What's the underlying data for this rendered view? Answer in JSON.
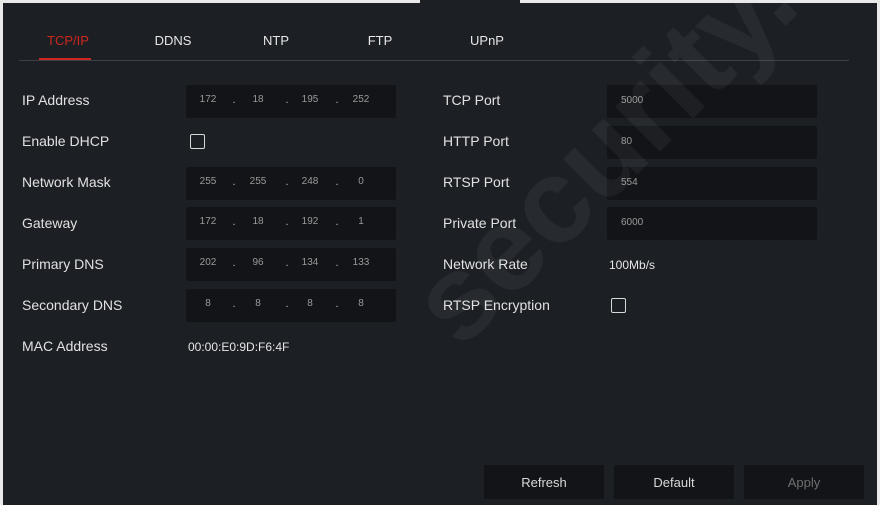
{
  "tabs": [
    {
      "label": "TCP/IP",
      "active": true
    },
    {
      "label": "DDNS",
      "active": false
    },
    {
      "label": "NTP",
      "active": false
    },
    {
      "label": "FTP",
      "active": false
    },
    {
      "label": "UPnP",
      "active": false
    }
  ],
  "left": {
    "ip_address": {
      "label": "IP Address",
      "octets": [
        "172",
        "18",
        "195",
        "252"
      ]
    },
    "enable_dhcp": {
      "label": "Enable DHCP",
      "checked": false
    },
    "network_mask": {
      "label": "Network Mask",
      "octets": [
        "255",
        "255",
        "248",
        "0"
      ]
    },
    "gateway": {
      "label": "Gateway",
      "octets": [
        "172",
        "18",
        "192",
        "1"
      ]
    },
    "primary_dns": {
      "label": "Primary DNS",
      "octets": [
        "202",
        "96",
        "134",
        "133"
      ]
    },
    "secondary_dns": {
      "label": "Secondary DNS",
      "octets": [
        "8",
        "8",
        "8",
        "8"
      ]
    },
    "mac_address": {
      "label": "MAC Address",
      "value": "00:00:E0:9D:F6:4F"
    }
  },
  "right": {
    "tcp_port": {
      "label": "TCP Port",
      "value": "5000"
    },
    "http_port": {
      "label": "HTTP Port",
      "value": "80"
    },
    "rtsp_port": {
      "label": "RTSP Port",
      "value": "554"
    },
    "private_port": {
      "label": "Private Port",
      "value": "6000"
    },
    "network_rate": {
      "label": "Network Rate",
      "value": "100Mb/s"
    },
    "rtsp_encryption": {
      "label": "RTSP Encryption",
      "checked": false
    }
  },
  "buttons": {
    "refresh": "Refresh",
    "default": "Default",
    "apply": "Apply"
  },
  "watermark": "security.com",
  "colors": {
    "accent": "#d0261d",
    "background": "#1c1f24",
    "field": "#121418"
  }
}
